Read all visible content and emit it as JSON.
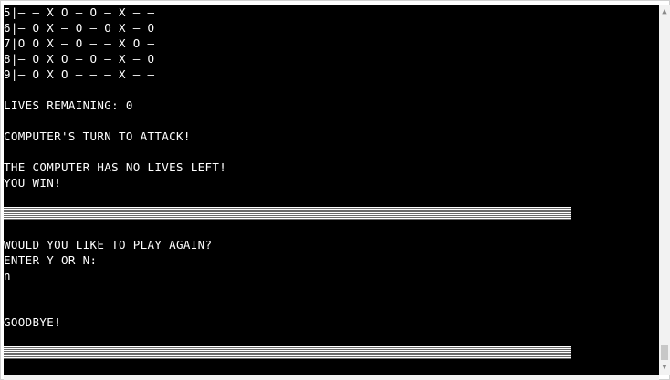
{
  "terminal": {
    "board_rows": [
      "5|— — X O — O — X — —",
      "6|— O X — O — O X — O",
      "7|O O X — O — — X O —",
      "8|— O X O — O — X — O",
      "9|— O X O — — — X — —"
    ],
    "lives": "LIVES REMAINING: 0",
    "turn": "COMPUTER'S TURN TO ATTACK!",
    "no_lives": "THE COMPUTER HAS NO LIVES LEFT!",
    "win": "YOU WIN!",
    "play_again": "WOULD YOU LIKE TO PLAY AGAIN?",
    "prompt": "ENTER Y OR N:",
    "user_input": "n",
    "goodbye": "GOODBYE!"
  },
  "colors": {
    "background": "#000000",
    "text": "#ffffff"
  },
  "icons": {
    "scroll_up": "▲",
    "scroll_down": "▼"
  }
}
